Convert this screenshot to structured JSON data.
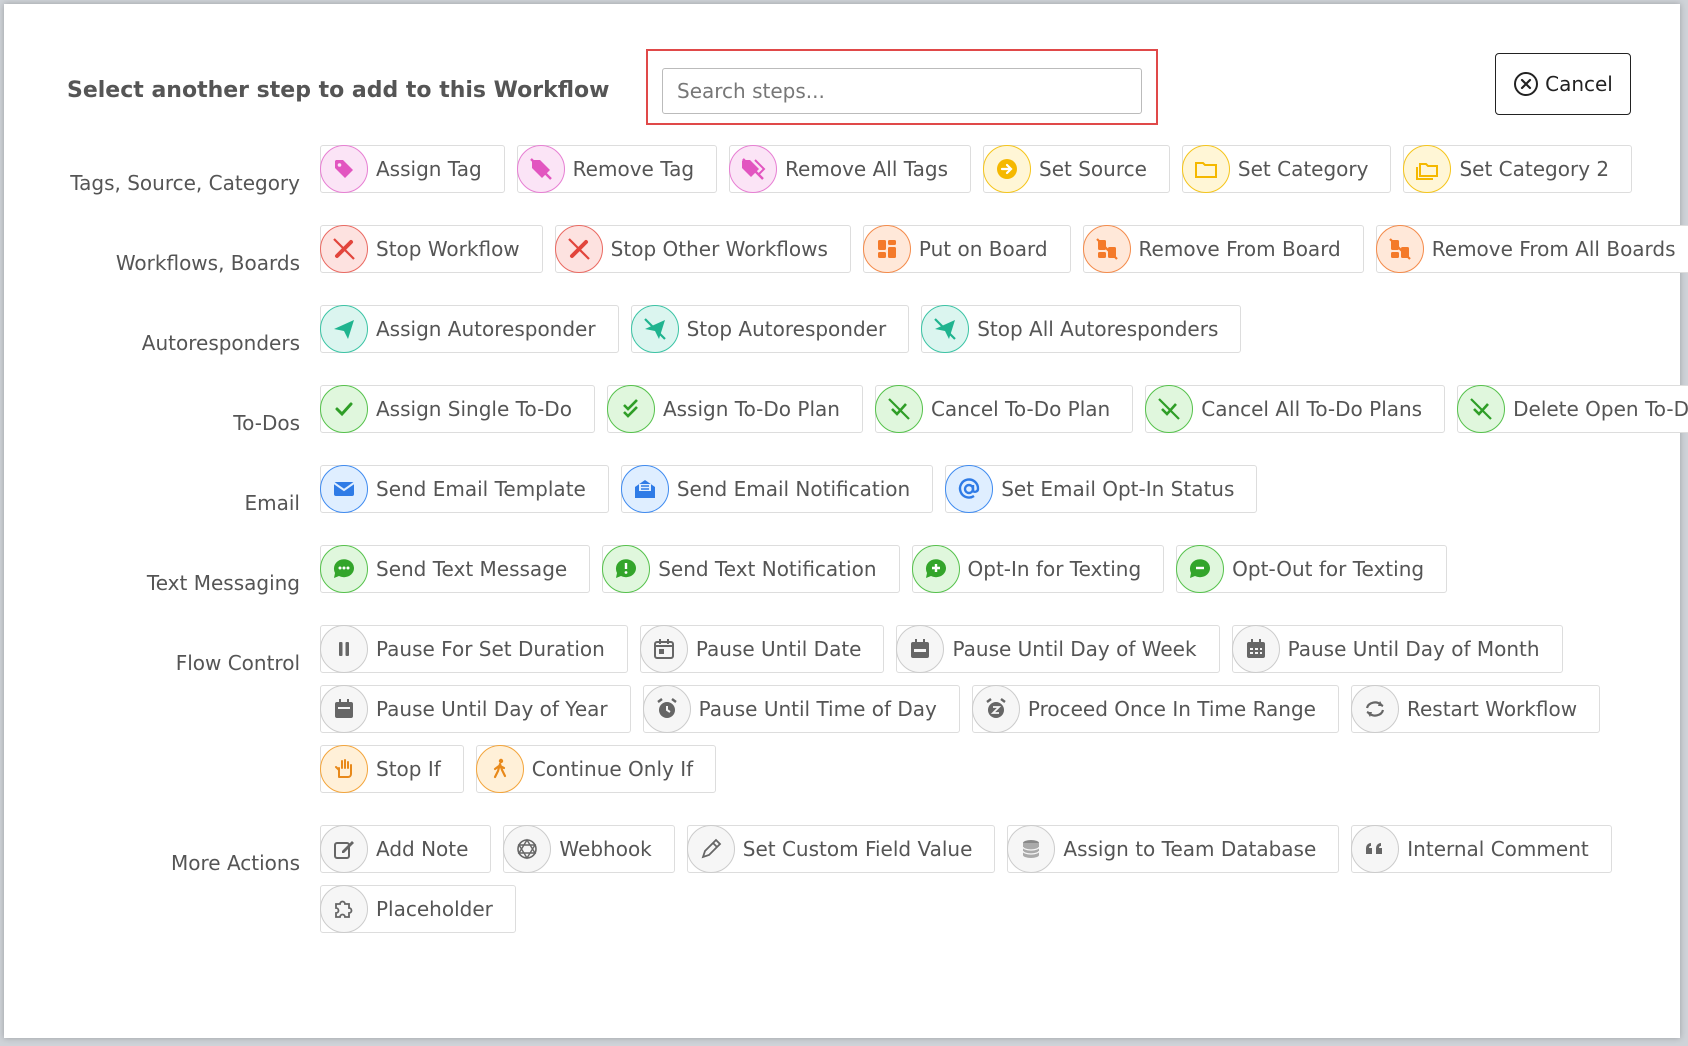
{
  "modal": {
    "title": "Select another step to add to this Workflow",
    "search_placeholder": "Search steps...",
    "search_value": "",
    "cancel_label": "Cancel"
  },
  "colors": {
    "tags": "#e77fd3",
    "source": "#f5c51b",
    "workflow": "#ea6a62",
    "board": "#f48b4b",
    "autoresponder": "#3bc4a5",
    "todo": "#56c24c",
    "email": "#3f8bf0",
    "text": "#56c24c",
    "flow": "#8a8a8a",
    "stop": "#f3a53c",
    "highlight": "#e04949"
  },
  "sections": [
    {
      "label": "Tags, Source, Category",
      "rows": [
        [
          {
            "label": "Assign Tag",
            "icon": "tag-icon"
          },
          {
            "label": "Remove Tag",
            "icon": "tag-slash-icon"
          },
          {
            "label": "Remove All Tags",
            "icon": "tags-slash-icon"
          },
          {
            "label": "Set Source",
            "icon": "arrow-circle-icon"
          },
          {
            "label": "Set Category",
            "icon": "folder-icon"
          },
          {
            "label": "Set Category 2",
            "icon": "folders-icon"
          }
        ]
      ]
    },
    {
      "label": "Workflows, Boards",
      "rows": [
        [
          {
            "label": "Stop Workflow",
            "icon": "workflow-slash-icon"
          },
          {
            "label": "Stop Other Workflows",
            "icon": "workflow-slash-icon"
          },
          {
            "label": "Put on Board",
            "icon": "board-icon"
          },
          {
            "label": "Remove From Board",
            "icon": "board-slash-icon"
          },
          {
            "label": "Remove From All Boards",
            "icon": "board-slash-icon"
          }
        ]
      ]
    },
    {
      "label": "Autoresponders",
      "rows": [
        [
          {
            "label": "Assign Autoresponder",
            "icon": "paper-plane-icon"
          },
          {
            "label": "Stop Autoresponder",
            "icon": "paper-plane-slash-icon"
          },
          {
            "label": "Stop All Autoresponders",
            "icon": "paper-plane-slash-icon"
          }
        ]
      ]
    },
    {
      "label": "To-Dos",
      "rows": [
        [
          {
            "label": "Assign Single To-Do",
            "icon": "check-icon"
          },
          {
            "label": "Assign To-Do Plan",
            "icon": "double-check-icon"
          },
          {
            "label": "Cancel To-Do Plan",
            "icon": "check-slash-icon"
          },
          {
            "label": "Cancel All To-Do Plans",
            "icon": "check-slash-icon"
          },
          {
            "label": "Delete Open To-Dos",
            "icon": "check-slash-icon"
          }
        ]
      ]
    },
    {
      "label": "Email",
      "rows": [
        [
          {
            "label": "Send Email Template",
            "icon": "envelope-icon"
          },
          {
            "label": "Send Email Notification",
            "icon": "envelope-open-icon"
          },
          {
            "label": "Set Email Opt-In Status",
            "icon": "at-icon"
          }
        ]
      ]
    },
    {
      "label": "Text Messaging",
      "rows": [
        [
          {
            "label": "Send Text Message",
            "icon": "chat-dots-icon"
          },
          {
            "label": "Send Text Notification",
            "icon": "chat-alert-icon"
          },
          {
            "label": "Opt-In for Texting",
            "icon": "chat-plus-icon"
          },
          {
            "label": "Opt-Out for Texting",
            "icon": "chat-minus-icon"
          }
        ]
      ]
    },
    {
      "label": "Flow Control",
      "rows": [
        [
          {
            "label": "Pause For Set Duration",
            "icon": "pause-icon"
          },
          {
            "label": "Pause Until Date",
            "icon": "calendar-day-icon"
          },
          {
            "label": "Pause Until Day of Week",
            "icon": "calendar-week-icon"
          },
          {
            "label": "Pause Until Day of Month",
            "icon": "calendar-month-icon"
          }
        ],
        [
          {
            "label": "Pause Until Day of Year",
            "icon": "calendar-year-icon"
          },
          {
            "label": "Pause Until Time of Day",
            "icon": "alarm-clock-icon"
          },
          {
            "label": "Proceed Once In Time Range",
            "icon": "alarm-snooze-icon"
          },
          {
            "label": "Restart Workflow",
            "icon": "restart-icon"
          }
        ],
        [
          {
            "label": "Stop If",
            "icon": "hand-stop-icon"
          },
          {
            "label": "Continue Only If",
            "icon": "walking-icon"
          }
        ]
      ]
    },
    {
      "label": "More Actions",
      "rows": [
        [
          {
            "label": "Add Note",
            "icon": "edit-icon"
          },
          {
            "label": "Webhook",
            "icon": "webhook-icon"
          },
          {
            "label": "Set Custom Field Value",
            "icon": "pencil-icon"
          },
          {
            "label": "Assign to Team Database",
            "icon": "database-icon"
          },
          {
            "label": "Internal Comment",
            "icon": "quote-icon"
          }
        ],
        [
          {
            "label": "Placeholder",
            "icon": "puzzle-icon"
          }
        ]
      ]
    }
  ]
}
